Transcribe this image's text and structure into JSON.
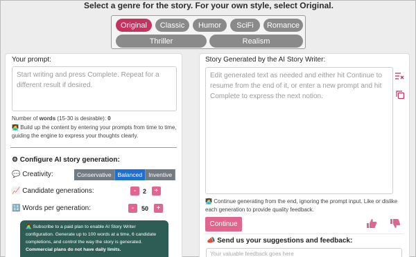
{
  "header": {
    "title": "Select a genre for the story. For your own style, select Original."
  },
  "genres": {
    "original": "Original",
    "classic": "Classic",
    "humor": "Humor",
    "scifi": "SciFi",
    "romance": "Romance",
    "thriller": "Thriller",
    "realism": "Realism",
    "selected": "Original"
  },
  "left": {
    "prompt_label": "Your prompt:",
    "prompt_placeholder": "Start writing and press Complete. Repeat for a different result if desired.",
    "word_count_prefix": "Number of ",
    "word_count_bold": "words",
    "word_count_suffix": " (15-30 is desirable): ",
    "word_count_value": "0",
    "hint": "Build up the content by entering your prompts from time to time, guiding the engine to express your thoughts clearly.",
    "config_title": "Configure AI story generation:",
    "creativity_label": "Creativity:",
    "creativity_options": [
      "Conservative",
      "Balanced",
      "Inventive"
    ],
    "creativity_selected": "Balanced",
    "candidates_label": "Candidate generations:",
    "candidates_value": "2",
    "words_label": "Words per generation:",
    "words_value": "50",
    "promo_text": "Subscribe to a paid plan to enable AI Story Writer configuration. Generate up to 100 words at a time, 6 candidate completions, and control the way the story is generated.",
    "promo_bold": "Commercial plans do not have daily limits."
  },
  "right": {
    "title": "Story Generated by the AI Story Writer:",
    "story_placeholder": "Edit generated text as needed and either hit Continue to resume from the end of it, or enter a new prompt and hit Complete to express the next notion.",
    "hint": "Continue generating from the end, ignoring the prompt input. Like or dislike each generation to provide quality feedback.",
    "continue_label": "Continue",
    "feedback_title": "Send us your suggestions and feedback:",
    "feedback_placeholder": "Your valuable feedback goes here"
  },
  "colors": {
    "accent": "#e0668e",
    "selected_genre": "#c2335f",
    "promo_bg": "#2e5d56",
    "segment_on": "#1f6fd1"
  },
  "icons": [
    "clear-icon",
    "copy-icon",
    "thumbs-up-icon",
    "thumbs-down-icon",
    "chat-icon",
    "chart-icon",
    "counter-icon",
    "gear-icon",
    "writer-emoji-icon",
    "megaphone-icon"
  ]
}
